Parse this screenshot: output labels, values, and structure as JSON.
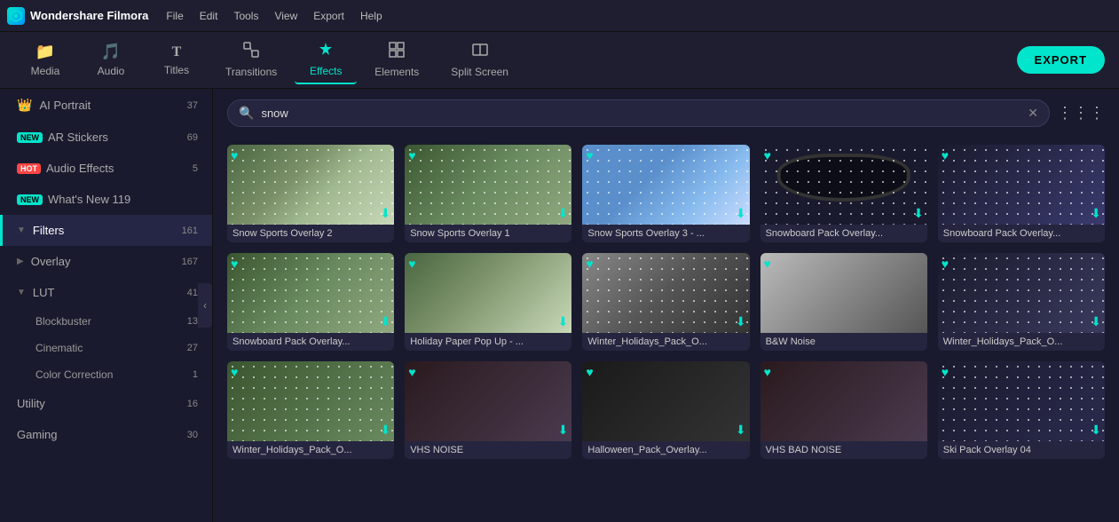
{
  "app": {
    "name": "Wondershare Filmora",
    "logo_text": "W"
  },
  "menu": {
    "items": [
      "File",
      "Edit",
      "Tools",
      "View",
      "Export",
      "Help"
    ]
  },
  "toolbar": {
    "items": [
      {
        "id": "media",
        "label": "Media",
        "icon": "📁"
      },
      {
        "id": "audio",
        "label": "Audio",
        "icon": "🎵"
      },
      {
        "id": "titles",
        "label": "Titles",
        "icon": "T"
      },
      {
        "id": "transitions",
        "label": "Transitions",
        "icon": "⬡"
      },
      {
        "id": "effects",
        "label": "Effects",
        "icon": "✦"
      },
      {
        "id": "elements",
        "label": "Elements",
        "icon": "⬜"
      },
      {
        "id": "split-screen",
        "label": "Split Screen",
        "icon": "⊞"
      }
    ],
    "active": "effects",
    "export_label": "EXPORT"
  },
  "search": {
    "value": "snow",
    "placeholder": "snow"
  },
  "sidebar": {
    "items": [
      {
        "id": "ai-portrait",
        "label": "AI Portrait",
        "count": "37",
        "type": "crown"
      },
      {
        "id": "ar-stickers",
        "label": "AR Stickers",
        "count": "69",
        "tag": "new"
      },
      {
        "id": "audio-effects",
        "label": "Audio Effects",
        "count": "5",
        "tag": "hot"
      },
      {
        "id": "whats-new",
        "label": "What's New 119",
        "count": "",
        "tag": "new"
      },
      {
        "id": "filters",
        "label": "Filters",
        "count": "161",
        "active": true,
        "expandable": true,
        "expanded": true
      },
      {
        "id": "overlay",
        "label": "Overlay",
        "count": "167",
        "expandable": true
      },
      {
        "id": "lut",
        "label": "LUT",
        "count": "41",
        "expandable": true,
        "expanded": true
      }
    ],
    "sub_items": [
      {
        "id": "blockbuster",
        "label": "Blockbuster",
        "count": "13"
      },
      {
        "id": "cinematic",
        "label": "Cinematic",
        "count": "27"
      },
      {
        "id": "color-correction",
        "label": "Color Correction",
        "count": "1"
      }
    ],
    "bottom_items": [
      {
        "id": "utility",
        "label": "Utility",
        "count": "16"
      },
      {
        "id": "gaming",
        "label": "Gaming",
        "count": "30"
      }
    ]
  },
  "thumbnails": [
    {
      "id": "1",
      "label": "Snow Sports Overlay 2",
      "bg": "bg-1",
      "snow": true,
      "fav": true,
      "dl": true
    },
    {
      "id": "2",
      "label": "Snow Sports Overlay 1",
      "bg": "bg-2",
      "snow": true,
      "fav": true,
      "dl": true
    },
    {
      "id": "3",
      "label": "Snow Sports Overlay 3 - ...",
      "bg": "bg-3",
      "snow": true,
      "fav": true,
      "dl": true
    },
    {
      "id": "4",
      "label": "Snowboard Pack Overlay...",
      "bg": "bg-4",
      "goggles": true,
      "fav": true,
      "dl": true
    },
    {
      "id": "5",
      "label": "Snowboard Pack Overlay...",
      "bg": "bg-5",
      "snow": true,
      "fav": true,
      "dl": true
    },
    {
      "id": "6",
      "label": "Snowboard Pack Overlay...",
      "bg": "bg-6",
      "snow": true,
      "fav": true,
      "dl": true
    },
    {
      "id": "7",
      "label": "Holiday Paper Pop Up - ...",
      "bg": "bg-7",
      "snow": false,
      "fav": true,
      "dl": true
    },
    {
      "id": "8",
      "label": "Winter_Holidays_Pack_O...",
      "bg": "bg-8",
      "snow": true,
      "fav": true,
      "dl": true
    },
    {
      "id": "9",
      "label": "B&W Noise",
      "bg": "bg-8",
      "snow": false,
      "fav": true,
      "dl": false
    },
    {
      "id": "10",
      "label": "Winter_Holidays_Pack_O...",
      "bg": "bg-9",
      "snow": true,
      "fav": true,
      "dl": true
    },
    {
      "id": "11",
      "label": "Winter_Holidays_Pack_O...",
      "bg": "bg-10",
      "snow": true,
      "fav": true,
      "dl": true
    },
    {
      "id": "12",
      "label": "VHS NOISE",
      "bg": "bg-11",
      "snow": false,
      "fav": true,
      "dl": true
    },
    {
      "id": "13",
      "label": "Halloween_Pack_Overlay...",
      "bg": "bg-12",
      "snow": false,
      "fav": true,
      "dl": true
    },
    {
      "id": "14",
      "label": "VHS BAD NOISE",
      "bg": "bg-11",
      "snow": false,
      "fav": true,
      "dl": false
    },
    {
      "id": "15",
      "label": "Ski Pack Overlay 04",
      "bg": "bg-15",
      "snow": true,
      "fav": true,
      "dl": true
    }
  ]
}
